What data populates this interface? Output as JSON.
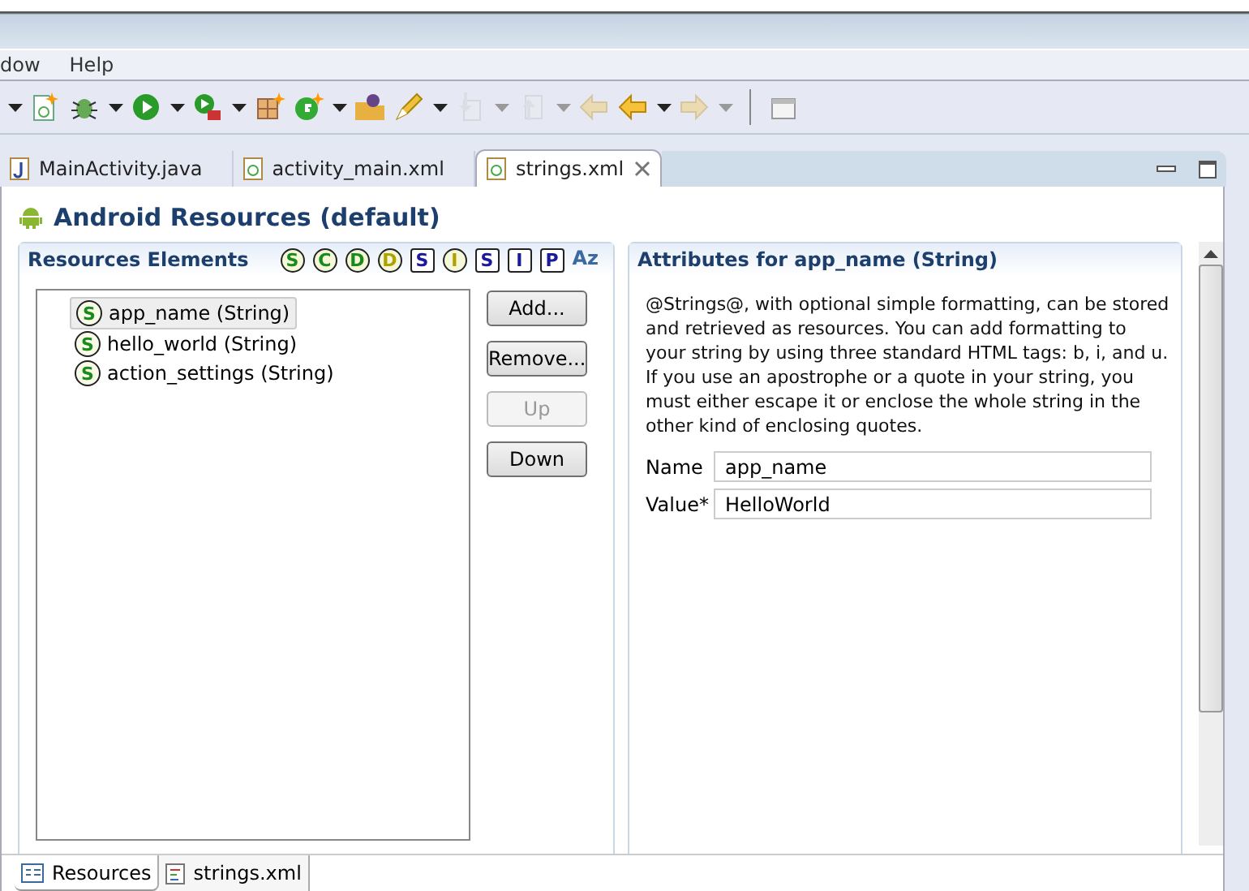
{
  "menu": [
    "dow",
    "Help"
  ],
  "toolbar": [
    {
      "kind": "caret",
      "disabled": false,
      "dropdown": true
    },
    {
      "kind": "newdoc",
      "disabled": false,
      "dropdown": false
    },
    {
      "kind": "bug",
      "disabled": false,
      "dropdown": true
    },
    {
      "kind": "run",
      "disabled": false,
      "dropdown": true
    },
    {
      "kind": "runtool",
      "disabled": false,
      "dropdown": true
    },
    {
      "kind": "grid",
      "disabled": false,
      "dropdown": false
    },
    {
      "kind": "gplus",
      "disabled": false,
      "dropdown": true
    },
    {
      "kind": "folder",
      "disabled": false,
      "dropdown": false
    },
    {
      "kind": "pen",
      "disabled": false,
      "dropdown": true
    },
    {
      "kind": "down",
      "disabled": true,
      "dropdown": true
    },
    {
      "kind": "up",
      "disabled": true,
      "dropdown": true
    },
    {
      "kind": "back",
      "disabled": true,
      "dropdown": false
    },
    {
      "kind": "back",
      "disabled": false,
      "dropdown": true
    },
    {
      "kind": "forward",
      "disabled": true,
      "dropdown": true
    },
    {
      "kind": "sep"
    },
    {
      "kind": "window",
      "disabled": false,
      "dropdown": false
    }
  ],
  "editor_tabs": [
    {
      "label": "MainActivity.java",
      "kind": "java",
      "selected": false
    },
    {
      "label": "activity_main.xml",
      "kind": "xml",
      "selected": false
    },
    {
      "label": "strings.xml",
      "kind": "xml",
      "selected": true
    }
  ],
  "title": "Android Resources (default)",
  "elements": {
    "heading": "Resources Elements",
    "filters": [
      {
        "letter": "S",
        "kind": "circle",
        "color": "#1a8a1a"
      },
      {
        "letter": "C",
        "kind": "circle",
        "color": "#1a8a1a"
      },
      {
        "letter": "D",
        "kind": "circle",
        "color": "#1a8a1a"
      },
      {
        "letter": "D",
        "kind": "circle",
        "color": "#b0a000"
      },
      {
        "letter": "S",
        "kind": "square",
        "color": "#1a1a9a"
      },
      {
        "letter": "I",
        "kind": "circle",
        "color": "#b0a000"
      },
      {
        "letter": "S",
        "kind": "square",
        "color": "#1a1a9a"
      },
      {
        "letter": "I",
        "kind": "square",
        "color": "#1a1a9a"
      },
      {
        "letter": "P",
        "kind": "square",
        "color": "#1a1a9a"
      },
      {
        "letter": "Az",
        "kind": "sort",
        "color": "#3a6aa0"
      }
    ],
    "items": [
      {
        "icon": "S",
        "label": "app_name (String)",
        "selected": true
      },
      {
        "icon": "S",
        "label": "hello_world (String)",
        "selected": false
      },
      {
        "icon": "S",
        "label": "action_settings (String)",
        "selected": false
      }
    ],
    "buttons": [
      {
        "label": "Add...",
        "disabled": false
      },
      {
        "label": "Remove...",
        "disabled": false
      },
      {
        "label": "Up",
        "disabled": true
      },
      {
        "label": "Down",
        "disabled": false
      }
    ]
  },
  "attributes": {
    "heading": "Attributes for app_name (String)",
    "description": "@Strings@, with optional simple formatting, can be stored and retrieved as resources. You can add formatting to your string by using three standard HTML tags: b, i, and u. If you use an apostrophe or a quote in your string, you must either escape it or enclose the whole string in the other kind of enclosing quotes.",
    "fields": [
      {
        "label": "Name",
        "value": "app_name"
      },
      {
        "label": "Value*",
        "value": "HelloWorld"
      }
    ]
  },
  "bottom_tabs": [
    {
      "label": "Resources",
      "kind": "form",
      "selected": true
    },
    {
      "label": "strings.xml",
      "kind": "source",
      "selected": false
    }
  ]
}
